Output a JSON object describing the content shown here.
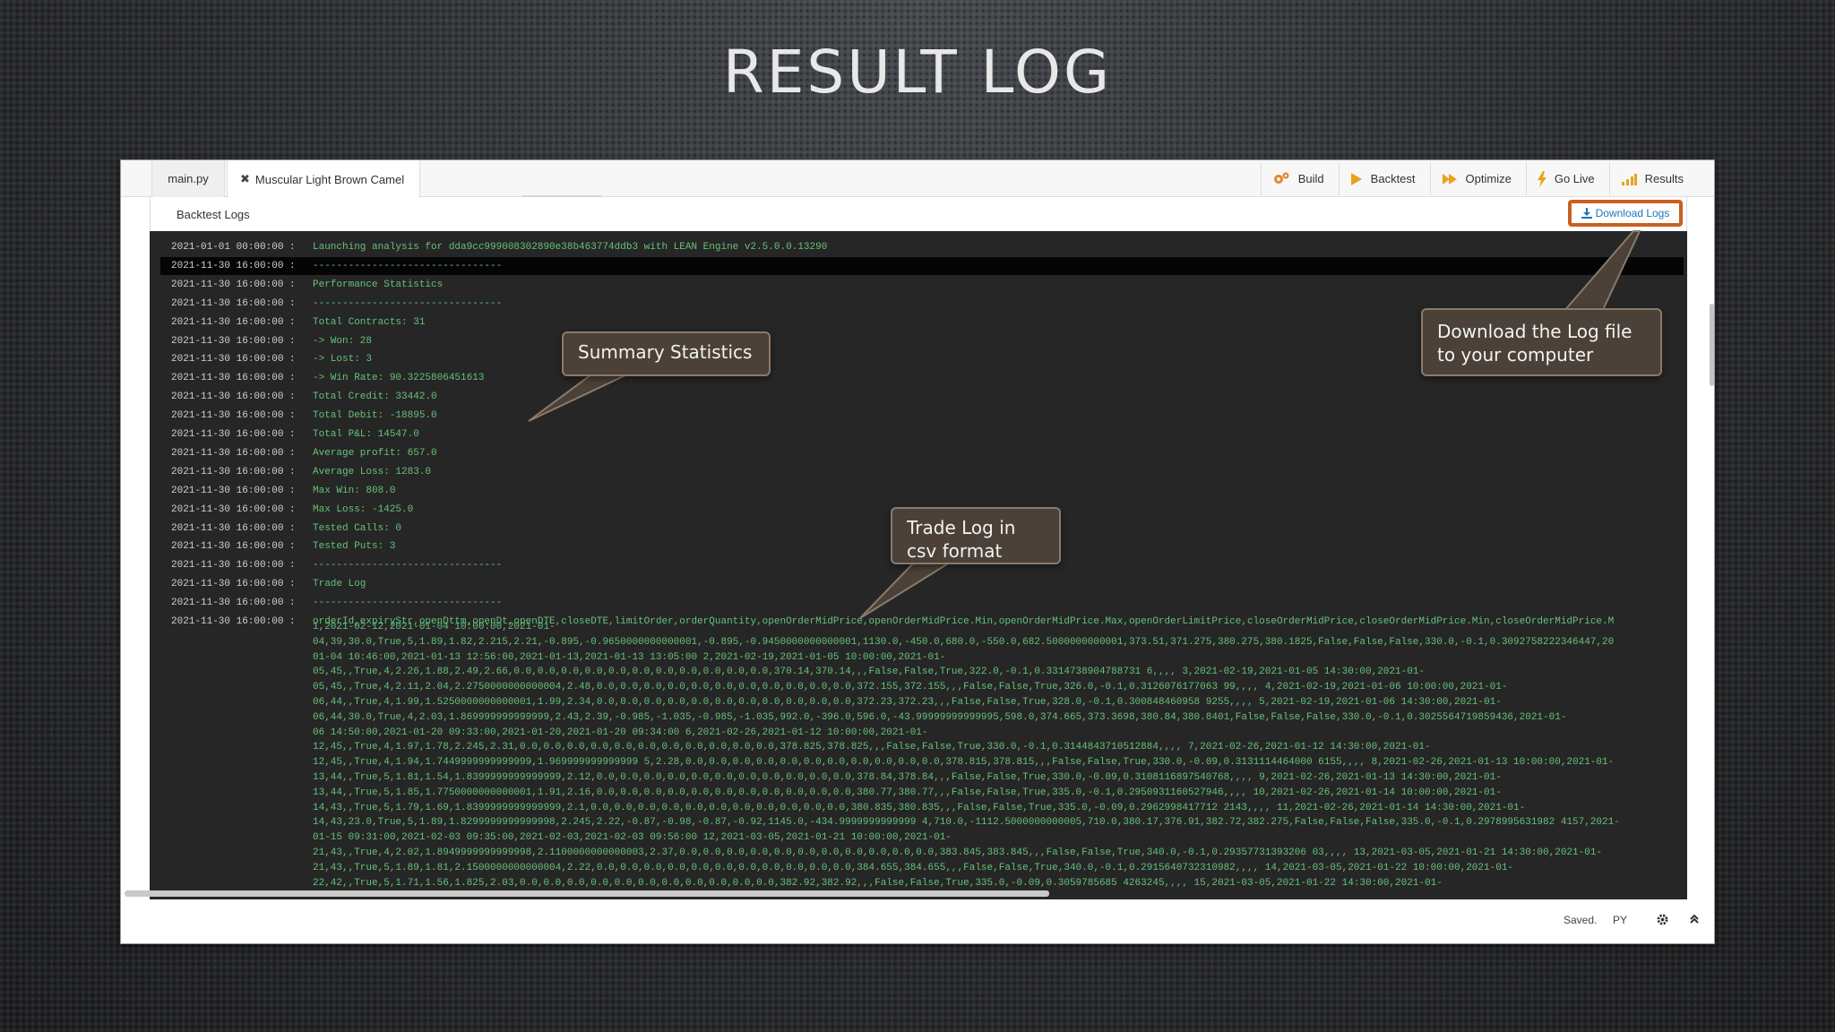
{
  "slide": {
    "title": "RESULT LOG"
  },
  "tabs": {
    "file": "main.py",
    "project": "Muscular Light Brown Camel",
    "close_glyph": "✖"
  },
  "toolbar": {
    "build": "Build",
    "backtest": "Backtest",
    "optimize": "Optimize",
    "go_live": "Go Live",
    "results": "Results"
  },
  "logs": {
    "title": "Backtest Logs",
    "download": "Download Logs",
    "lines": [
      {
        "ts": "2021-01-01 00:00:00 :",
        "msg": "Launching analysis for dda9cc999008302890e38b463774ddb3 with LEAN Engine v2.5.0.0.13290"
      },
      {
        "ts": "2021-11-30 16:00:00 :",
        "msg": "--------------------------------"
      },
      {
        "ts": "2021-11-30 16:00:00 :",
        "msg": "Performance Statistics"
      },
      {
        "ts": "2021-11-30 16:00:00 :",
        "msg": "--------------------------------"
      },
      {
        "ts": "2021-11-30 16:00:00 :",
        "msg": "Total Contracts: 31"
      },
      {
        "ts": "2021-11-30 16:00:00 :",
        "msg": "-> Won: 28"
      },
      {
        "ts": "2021-11-30 16:00:00 :",
        "msg": "-> Lost: 3"
      },
      {
        "ts": "2021-11-30 16:00:00 :",
        "msg": "-> Win Rate: 90.3225806451613"
      },
      {
        "ts": "2021-11-30 16:00:00 :",
        "msg": "Total Credit: 33442.0"
      },
      {
        "ts": "2021-11-30 16:00:00 :",
        "msg": "Total Debit: -18895.0"
      },
      {
        "ts": "2021-11-30 16:00:00 :",
        "msg": "Total P&L: 14547.0"
      },
      {
        "ts": "2021-11-30 16:00:00 :",
        "msg": "Average profit: 657.0"
      },
      {
        "ts": "2021-11-30 16:00:00 :",
        "msg": "Average Loss: 1283.0"
      },
      {
        "ts": "2021-11-30 16:00:00 :",
        "msg": "Max Win: 808.0"
      },
      {
        "ts": "2021-11-30 16:00:00 :",
        "msg": "Max Loss: -1425.0"
      },
      {
        "ts": "2021-11-30 16:00:00 :",
        "msg": "Tested Calls: 0"
      },
      {
        "ts": "2021-11-30 16:00:00 :",
        "msg": "Tested Puts: 3"
      },
      {
        "ts": "2021-11-30 16:00:00 :",
        "msg": "--------------------------------"
      },
      {
        "ts": "2021-11-30 16:00:00 :",
        "msg": "Trade Log"
      },
      {
        "ts": "2021-11-30 16:00:00 :",
        "msg": "--------------------------------"
      },
      {
        "ts": "2021-11-30 16:00:00 :",
        "msg": "orderId,expiryStr,openDttm,openDt,openDTE,closeDTE,limitOrder,orderQuantity,openOrderMidPrice,openOrderMidPrice.Min,openOrderMidPrice.Max,openOrderLimitPrice,closeOrderMidPrice,closeOrderMidPrice.Min,closeOrderMidPrice.M"
      }
    ],
    "csv_rows": [
      "1,2021-02-12,2021-01-04 10:00:00,2021-01-",
      "04,39,30.0,True,5,1.89,1.82,2.215,2.21,-0.895,-0.9650000000000001,-0.895,-0.9450000000000001,1130.0,-450.0,680.0,-550.0,682.5000000000001,373.51,371.275,380.275,380.1825,False,False,False,330.0,-0.1,0.3092758222346447,20",
      "01-04 10:46:00,2021-01-13 12:56:00,2021-01-13,2021-01-13 13:05:00 2,2021-02-19,2021-01-05 10:00:00,2021-01-",
      "05,45,,True,4,2.26,1.88,2.49,2.66,0.0,0.0,0.0,0.0,0.0,0.0,0.0,0.0,0.0,0.0,0.0,370.14,370.14,,,False,False,True,322.0,-0.1,0.3314738904788731 6,,,, 3,2021-02-19,2021-01-05 14:30:00,2021-01-",
      "05,45,,True,4,2.11,2.04,2.2750000000000004,2.48,0.0,0.0,0.0,0.0,0.0,0.0,0.0,0.0,0.0,0.0,0.0,372.155,372.155,,,False,False,True,326.0,-0.1,0.3126076177063 99,,,, 4,2021-02-19,2021-01-06 10:00:00,2021-01-",
      "06,44,,True,4,1.99,1.5250000000000001,1.99,2.34,0.0,0.0,0.0,0.0,0.0,0.0,0.0,0.0,0.0,0.0,0.0,372.23,372.23,,,False,False,True,328.0,-0.1,0.300848460958 9255,,,, 5,2021-02-19,2021-01-06 14:30:00,2021-01-",
      "06,44,30.0,True,4,2.03,1.869999999999999,2.43,2.39,-0.985,-1.035,-0.985,-1.035,992.0,-396.0,596.0,-43.99999999999995,598.0,374.665,373.3698,380.84,380.8401,False,False,False,330.0,-0.1,0.3025564719859436,2021-01-",
      "06 14:50:00,2021-01-20 09:33:00,2021-01-20,2021-01-20 09:34:00 6,2021-02-26,2021-01-12 10:00:00,2021-01-",
      "12,45,,True,4,1.97,1.78,2.245,2.31,0.0,0.0,0.0,0.0,0.0,0.0,0.0,0.0,0.0,0.0,0.0,378.825,378.825,,,False,False,True,330.0,-0.1,0.3144843710512884,,,, 7,2021-02-26,2021-01-12 14:30:00,2021-01-",
      "12,45,,True,4,1.94,1.7449999999999999,1.969999999999999 5,2.28,0.0,0.0,0.0,0.0,0.0,0.0,0.0,0.0,0.0,0.0,0.0,378.815,378.815,,,False,False,True,330.0,-0.09,0.3131114464000 6155,,,, 8,2021-02-26,2021-01-13 10:00:00,2021-01-",
      "13,44,,True,5,1.81,1.54,1.8399999999999999,2.12,0.0,0.0,0.0,0.0,0.0,0.0,0.0,0.0,0.0,0.0,0.0,378.84,378.84,,,False,False,True,330.0,-0.09,0.3108116897540768,,,, 9,2021-02-26,2021-01-13 14:30:00,2021-01-",
      "13,44,,True,5,1.85,1.7750000000000001,1.91,2.16,0.0,0.0,0.0,0.0,0.0,0.0,0.0,0.0,0.0,0.0,0.0,380.77,380.77,,,False,False,True,335.0,-0.1,0.2950931160527946,,,, 10,2021-02-26,2021-01-14 10:00:00,2021-01-",
      "14,43,,True,5,1.79,1.69,1.8399999999999999,2.1,0.0,0.0,0.0,0.0,0.0,0.0,0.0,0.0,0.0,0.0,0.0,380.835,380.835,,,False,False,True,335.0,-0.09,0.2962998417712 2143,,,, 11,2021-02-26,2021-01-14 14:30:00,2021-01-",
      "14,43,23.0,True,5,1.89,1.8299999999999998,2.245,2.22,-0.87,-0.98,-0.87,-0.92,1145.0,-434.9999999999999 4,710.0,-1112.5000000000005,710.0,380.17,376.91,382.72,382.275,False,False,False,335.0,-0.1,0.2978995631982 4157,2021-",
      "01-15 09:31:00,2021-02-03 09:35:00,2021-02-03,2021-02-03 09:56:00 12,2021-03-05,2021-01-21 10:00:00,2021-01-",
      "21,43,,True,4,2.02,1.8949999999999998,2.1100000000000003,2.37,0.0,0.0,0.0,0.0,0.0,0.0,0.0,0.0,0.0,0.0,0.0,383.845,383.845,,,False,False,True,340.0,-0.1,0.29357731393206 03,,,, 13,2021-03-05,2021-01-21 14:30:00,2021-01-",
      "21,43,,True,5,1.89,1.81,2.1500000000000004,2.22,0.0,0.0,0.0,0.0,0.0,0.0,0.0,0.0,0.0,0.0,0.0,384.655,384.655,,,False,False,True,340.0,-0.1,0.2915640732310982,,,, 14,2021-03-05,2021-01-22 10:00:00,2021-01-",
      "22,42,,True,5,1.71,1.56,1.825,2.03,0.0,0.0,0.0,0.0,0.0,0.0,0.0,0.0,0.0,0.0,0.0,382.92,382.92,,,False,False,True,335.0,-0.09,0.3059785685 4263245,,,, 15,2021-03-05,2021-01-22 14:30:00,2021-01-"
    ]
  },
  "status": {
    "saved": "Saved.",
    "lang": "PY"
  },
  "callouts": {
    "summary": "Summary Statistics",
    "trade_log_1": "Trade Log in",
    "trade_log_2": "csv format",
    "download_1": "Download the Log file",
    "download_2": "to your computer"
  },
  "colors": {
    "accent_orange": "#c8601e",
    "log_green": "#66c27a",
    "console_bg": "#262626",
    "callout_bg": "#4b4138"
  }
}
